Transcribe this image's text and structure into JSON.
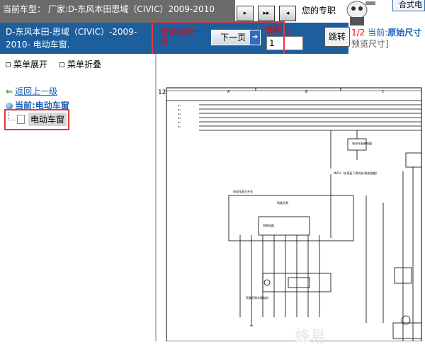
{
  "topbar": {
    "text": "当前车型：  厂家:D-东风本田思域（CIVIC）2009-2010"
  },
  "toolbar": {
    "welcome": "您的专职",
    "shop_text": "合式电"
  },
  "header": {
    "title": "D-东风本田-思域（CIVIC）-2009-2010- 电动车窗."
  },
  "pager": {
    "current_page_label": "当前为第一页",
    "next_label": "下一页",
    "current_for_label": "当前为",
    "page_input": "1",
    "jump_label": "跳转",
    "page_count": "1/2",
    "current_label": "当前:",
    "original_size_label": "原始尺寸",
    "preview_size_label": "预览尺寸]"
  },
  "menu": {
    "expand": "菜单展开",
    "collapse": "菜单折叠"
  },
  "nav": {
    "back_label": "返回上一级",
    "current_label": "当前:电动车窗"
  },
  "tree": {
    "items": [
      {
        "label": "电动车窗"
      }
    ]
  },
  "diagram": {
    "page_number": "12",
    "column_letters": [
      "A",
      "B",
      "C"
    ],
    "labels": [
      "电动车窗主开关",
      "驾驶员侧",
      "控制电路",
      "驾驶员侧车窗电机",
      "电动车窗继电器",
      "MICU（仪表板下保险丝/继电器盒）"
    ]
  },
  "watermark": "蜂易",
  "colors": {
    "header_blue": "#1d5f9d",
    "topbar_gray": "#6b6b6b",
    "highlight_red": "#e23a3a"
  }
}
